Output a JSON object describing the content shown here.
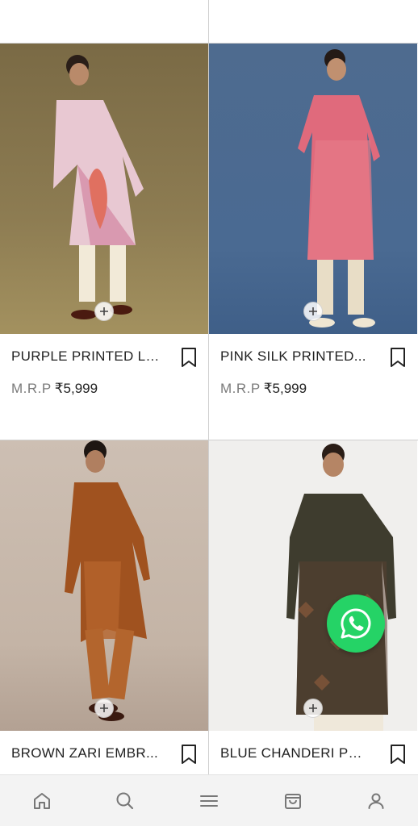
{
  "products": [
    {
      "title": "PURPLE PRINTED LI...",
      "mrp_label": "M.R.P",
      "price": "₹5,999"
    },
    {
      "title": "PINK SILK PRINTED...",
      "mrp_label": "M.R.P",
      "price": "₹5,999"
    },
    {
      "title": "BROWN ZARI EMBR...",
      "mrp_label": "",
      "price": ""
    },
    {
      "title": "BLUE CHANDERI PR...",
      "mrp_label": "",
      "price": ""
    }
  ],
  "icons": {
    "add": "plus-icon",
    "wishlist": "bookmark-icon",
    "chat": "whatsapp-icon"
  },
  "bottom_nav": [
    "home-icon",
    "search-icon",
    "menu-icon",
    "bag-icon",
    "profile-icon"
  ],
  "colors": {
    "whatsapp": "#25d366",
    "nav_bg": "#f3f3f3",
    "divider": "#cfcfcf"
  }
}
